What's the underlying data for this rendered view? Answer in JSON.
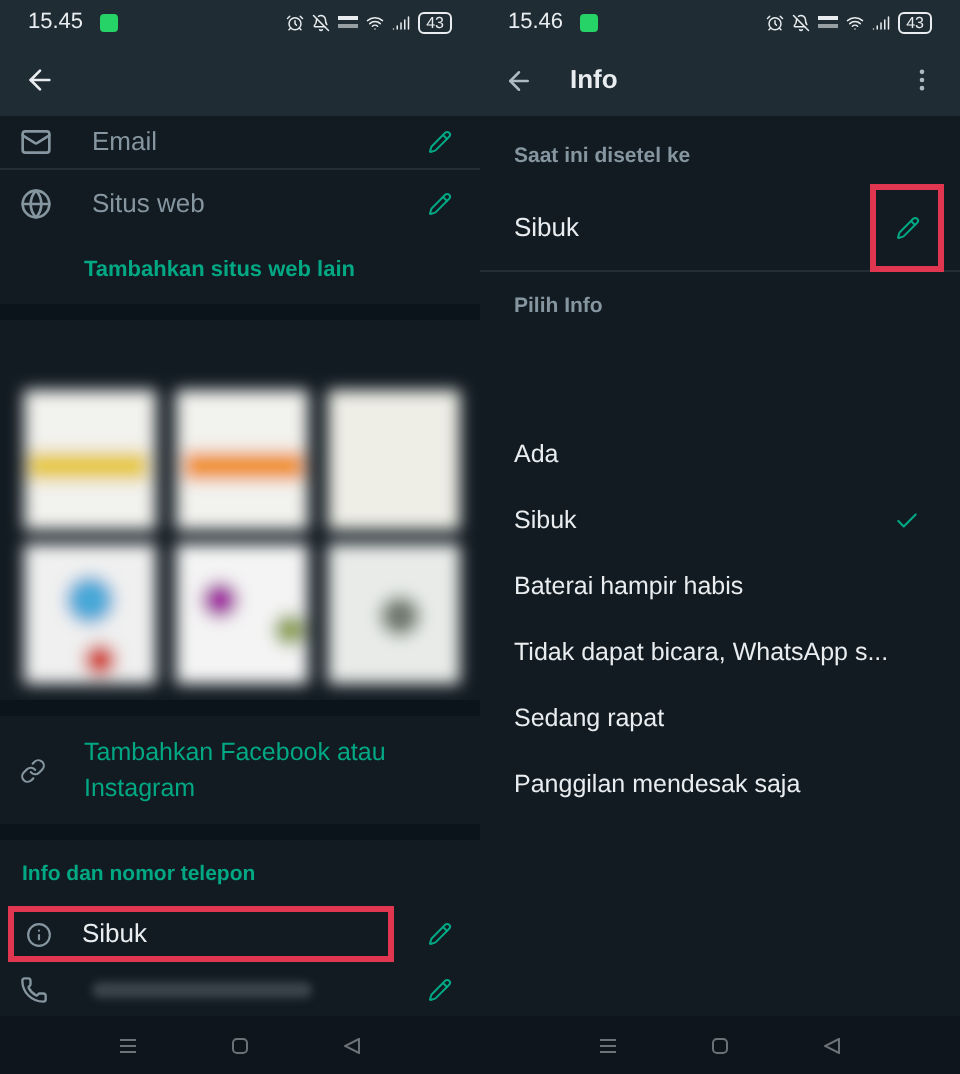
{
  "screens": [
    {
      "status_bar": {
        "time": "15.45",
        "battery": "43"
      },
      "contact_rows": [
        {
          "kind": "email",
          "label": "Email"
        },
        {
          "kind": "website",
          "label": "Situs web"
        }
      ],
      "add_website_link": "Tambahkan situs web lain",
      "facebook_link": "Tambahkan Facebook atau Instagram",
      "section_header": "Info dan nomor telepon",
      "info_row": {
        "value": "Sibuk",
        "highlighted": true
      },
      "phone_row": {
        "kind": "phone"
      }
    },
    {
      "status_bar": {
        "time": "15.46",
        "battery": "43"
      },
      "title": "Info",
      "current_label": "Saat ini disetel ke",
      "current_value": "Sibuk",
      "edit_highlighted": true,
      "choose_label": "Pilih Info",
      "options": [
        {
          "label": "Ada",
          "selected": false
        },
        {
          "label": "Sibuk",
          "selected": true
        },
        {
          "label": "Baterai hampir habis",
          "selected": false
        },
        {
          "label": "Tidak dapat bicara, WhatsApp s...",
          "selected": false
        },
        {
          "label": "Sedang rapat",
          "selected": false
        },
        {
          "label": "Panggilan mendesak saja",
          "selected": false
        }
      ]
    }
  ]
}
